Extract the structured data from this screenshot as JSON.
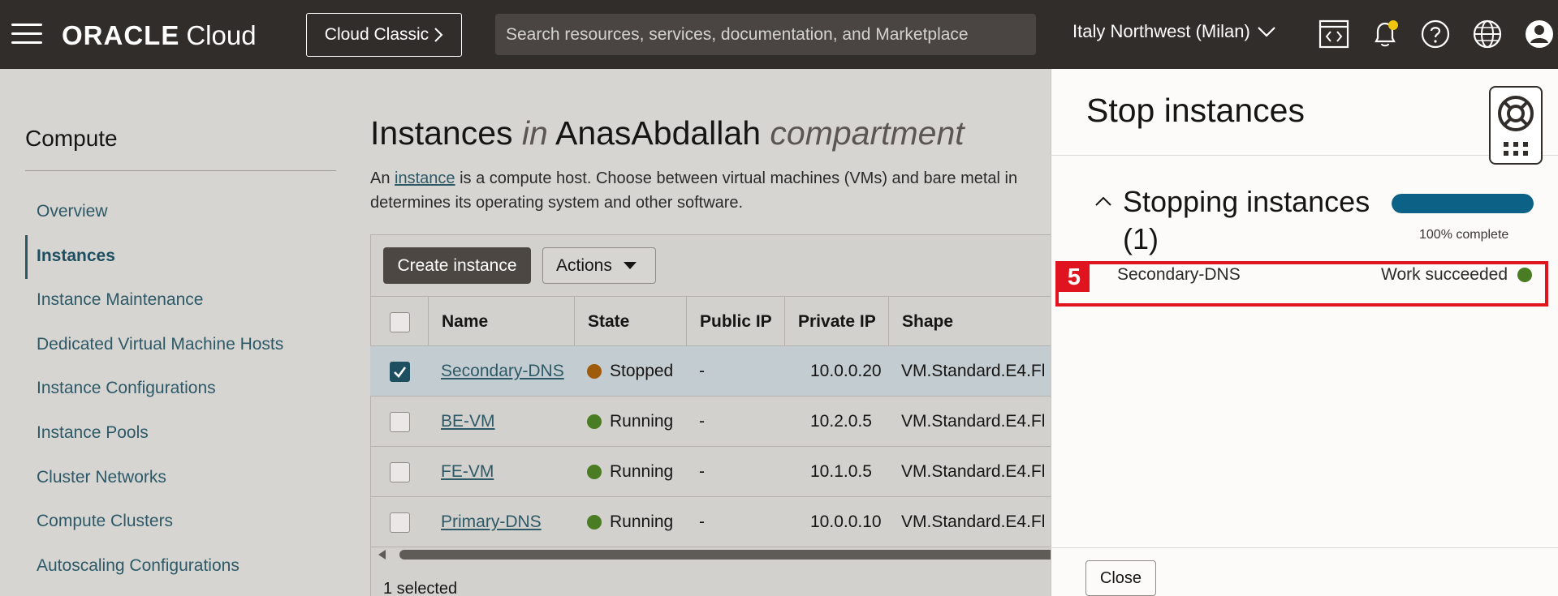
{
  "header": {
    "logo_brand": "ORACLE",
    "logo_product": "Cloud",
    "classic_label": "Cloud Classic",
    "search_placeholder": "Search resources, services, documentation, and Marketplace",
    "region": "Italy Northwest (Milan)",
    "icons": [
      "menu-icon",
      "code-editor-icon",
      "bell-icon",
      "help-icon",
      "globe-icon",
      "user-icon"
    ]
  },
  "sidebar": {
    "title": "Compute",
    "items": [
      {
        "label": "Overview",
        "active": false
      },
      {
        "label": "Instances",
        "active": true
      },
      {
        "label": "Instance Maintenance",
        "active": false
      },
      {
        "label": "Dedicated Virtual Machine Hosts",
        "active": false
      },
      {
        "label": "Instance Configurations",
        "active": false
      },
      {
        "label": "Instance Pools",
        "active": false
      },
      {
        "label": "Cluster Networks",
        "active": false
      },
      {
        "label": "Compute Clusters",
        "active": false
      },
      {
        "label": "Autoscaling Configurations",
        "active": false
      }
    ]
  },
  "main": {
    "title_part1": "Instances",
    "title_in": "in",
    "title_compartment": "AnasAbdallah",
    "title_part2": "compartment",
    "desc_prefix": "An",
    "desc_link": "instance",
    "desc_line1_rest": "is a compute host. Choose between virtual machines (VMs) and bare metal in",
    "desc_line2": "determines its operating system and other software.",
    "create_label": "Create instance",
    "actions_label": "Actions",
    "columns": [
      "Name",
      "State",
      "Public IP",
      "Private IP",
      "Shape"
    ],
    "rows": [
      {
        "name": "Secondary-DNS",
        "state": "Stopped",
        "public_ip": "-",
        "private_ip": "10.0.0.20",
        "shape": "VM.Standard.E4.Fl",
        "selected": true
      },
      {
        "name": "BE-VM",
        "state": "Running",
        "public_ip": "-",
        "private_ip": "10.2.0.5",
        "shape": "VM.Standard.E4.Fl",
        "selected": false
      },
      {
        "name": "FE-VM",
        "state": "Running",
        "public_ip": "-",
        "private_ip": "10.1.0.5",
        "shape": "VM.Standard.E4.Fl",
        "selected": false
      },
      {
        "name": "Primary-DNS",
        "state": "Running",
        "public_ip": "-",
        "private_ip": "10.0.0.10",
        "shape": "VM.Standard.E4.Fl",
        "selected": false
      }
    ],
    "selected_count": "1 selected"
  },
  "drawer": {
    "title": "Stop instances",
    "section_title": "Stopping instances (1)",
    "progress_percent": 100,
    "progress_label": "100% complete",
    "item_name": "Secondary-DNS",
    "item_status": "Work succeeded",
    "step_badge": "5",
    "close_label": "Close"
  },
  "colors": {
    "running": "#4a7c24",
    "stopped": "#a05a0b",
    "succeeded": "#4a7c24",
    "progress": "#0b6286",
    "highlight": "#e0141e"
  }
}
